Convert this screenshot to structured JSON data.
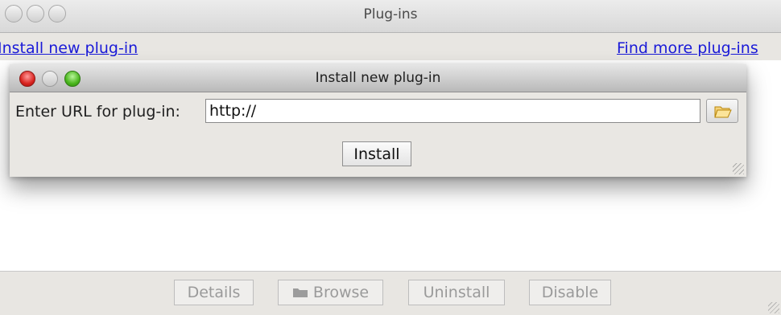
{
  "window": {
    "title": "Plug-ins",
    "links": {
      "install_new": "Install new plug-in",
      "find_more": "Find more plug-ins"
    }
  },
  "dialog": {
    "title": "Install new plug-in",
    "url_label": "Enter URL for plug-in:",
    "url_value": "http://",
    "install_button": "Install",
    "browse_icon": "folder-open-icon"
  },
  "bottom_buttons": {
    "details": "Details",
    "browse": "Browse",
    "browse_icon": "folder-icon",
    "uninstall": "Uninstall",
    "disable": "Disable"
  },
  "colors": {
    "link": "#1a1ad8",
    "close_light": "#d8231f",
    "zoom_light": "#49b51c"
  }
}
